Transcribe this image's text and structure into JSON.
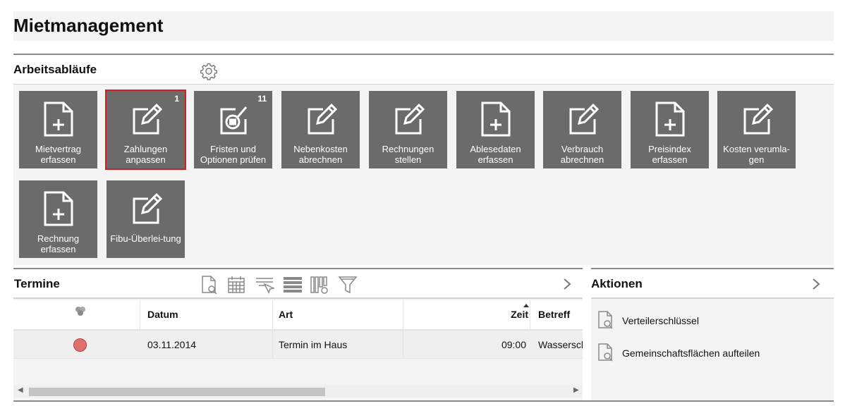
{
  "page": {
    "title": "Mietmanagement"
  },
  "workflows": {
    "title": "Arbeitsabläufe",
    "tiles": [
      {
        "label": "Mietvertrag erfassen",
        "icon": "doc-plus-icon",
        "badge": ""
      },
      {
        "label": "Zahlungen anpassen",
        "icon": "edit-icon",
        "badge": "1",
        "selected": true
      },
      {
        "label": "Fristen und Optionen prüfen",
        "icon": "list-edit-icon",
        "badge": "11"
      },
      {
        "label": "Nebenkosten abrechnen",
        "icon": "edit-icon",
        "badge": ""
      },
      {
        "label": "Rechnungen stellen",
        "icon": "edit-icon",
        "badge": ""
      },
      {
        "label": "Ablesedaten erfassen",
        "icon": "doc-plus-icon",
        "badge": ""
      },
      {
        "label": "Verbrauch abrechnen",
        "icon": "edit-icon",
        "badge": ""
      },
      {
        "label": "Preisindex erfassen",
        "icon": "doc-plus-icon",
        "badge": ""
      },
      {
        "label": "Kosten verumla-gen",
        "icon": "edit-icon",
        "badge": ""
      },
      {
        "label": "Rechnung erfassen",
        "icon": "doc-plus-icon",
        "badge": ""
      },
      {
        "label": "Fibu-Überlei-tung",
        "icon": "edit-icon",
        "badge": ""
      }
    ]
  },
  "termine": {
    "title": "Termine",
    "columns": {
      "datum": "Datum",
      "art": "Art",
      "zeit": "Zeit",
      "betreff": "Betreff"
    },
    "rows": [
      {
        "datum": "03.11.2014",
        "art": "Termin im Haus",
        "zeit": "09:00",
        "betreff": "Wasserschaden"
      }
    ],
    "status_color": "#e07070"
  },
  "aktionen": {
    "title": "Aktionen",
    "items": [
      {
        "label": "Verteilerschlüssel"
      },
      {
        "label": "Gemeinschaftsflächen aufteilen"
      }
    ]
  },
  "colors": {
    "tile_bg": "#6b6b6b",
    "selected_border": "#d01f1f",
    "accent_line": "#8a8a8a"
  }
}
